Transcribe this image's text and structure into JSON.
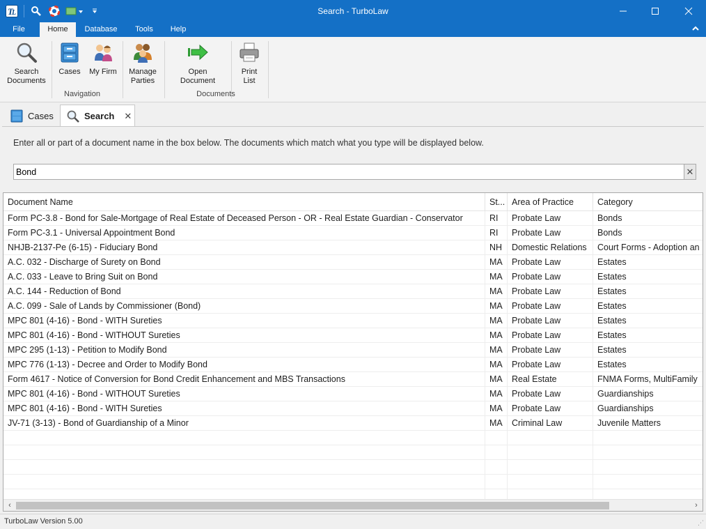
{
  "window": {
    "title": "Search - TurboLaw"
  },
  "ribbon_tabs": [
    "File",
    "Home",
    "Database",
    "Tools",
    "Help"
  ],
  "ribbon": {
    "navigation": {
      "label": "Navigation",
      "search_documents": "Search Documents",
      "cases": "Cases",
      "my_firm": "My Firm",
      "manage_parties": "Manage Parties"
    },
    "documents": {
      "label": "Documents",
      "open_document": "Open Document",
      "print_list": "Print List"
    }
  },
  "doc_tabs": {
    "cases": "Cases",
    "search": "Search"
  },
  "search": {
    "instructions": "Enter all or part of a document name in the box below. The documents which match what you type will be displayed below.",
    "value": "Bond"
  },
  "grid": {
    "headers": [
      "Document Name",
      "St...",
      "Area of Practice",
      "Category"
    ],
    "rows": [
      [
        "Form PC-3.8 - Bond for Sale-Mortgage of Real Estate of Deceased Person - OR - Real Estate Guardian - Conservator",
        "RI",
        "Probate Law",
        "Bonds"
      ],
      [
        "Form PC-3.1 - Universal Appointment Bond",
        "RI",
        "Probate Law",
        "Bonds"
      ],
      [
        "NHJB-2137-Pe (6-15) - Fiduciary Bond",
        "NH",
        "Domestic Relations",
        "Court Forms - Adoption an"
      ],
      [
        "A.C. 032 - Discharge of Surety on Bond",
        "MA",
        "Probate Law",
        "Estates"
      ],
      [
        "A.C. 033 - Leave to Bring Suit on Bond",
        "MA",
        "Probate Law",
        "Estates"
      ],
      [
        "A.C. 144 - Reduction of Bond",
        "MA",
        "Probate Law",
        "Estates"
      ],
      [
        "A.C. 099 - Sale of Lands by Commissioner (Bond)",
        "MA",
        "Probate Law",
        "Estates"
      ],
      [
        "MPC 801 (4-16) - Bond - WITH Sureties",
        "MA",
        "Probate Law",
        "Estates"
      ],
      [
        "MPC 801 (4-16) - Bond - WITHOUT Sureties",
        "MA",
        "Probate Law",
        "Estates"
      ],
      [
        "MPC 295 (1-13) - Petition to Modify Bond",
        "MA",
        "Probate Law",
        "Estates"
      ],
      [
        "MPC 776 (1-13) - Decree and Order to Modify Bond",
        "MA",
        "Probate Law",
        "Estates"
      ],
      [
        "Form 4617 - Notice of Conversion for Bond Credit Enhancement and MBS Transactions",
        "MA",
        "Real Estate",
        "FNMA Forms, MultiFamily"
      ],
      [
        "MPC 801 (4-16) - Bond - WITHOUT Sureties",
        "MA",
        "Probate Law",
        "Guardianships"
      ],
      [
        "MPC 801 (4-16) - Bond - WITH Sureties",
        "MA",
        "Probate Law",
        "Guardianships"
      ],
      [
        "JV-71 (3-13) - Bond of Guardianship of a Minor",
        "MA",
        "Criminal Law",
        "Juvenile Matters"
      ]
    ]
  },
  "status": {
    "text": "TurboLaw Version 5.00"
  }
}
